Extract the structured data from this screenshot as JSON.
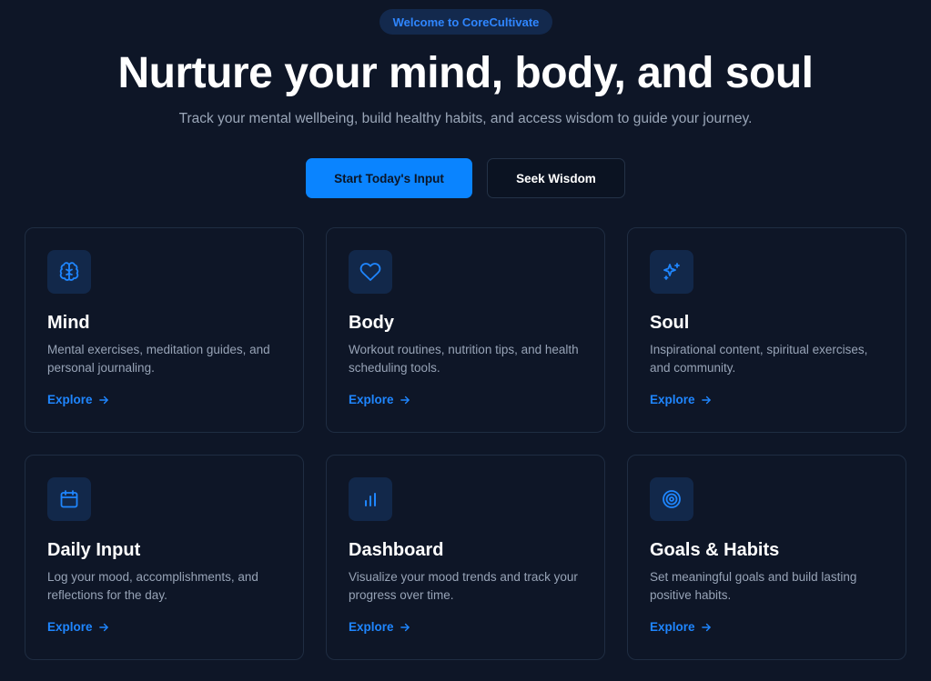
{
  "badge": "Welcome to CoreCultivate",
  "hero": {
    "title": "Nurture your mind, body, and soul",
    "subtitle": "Track your mental wellbeing, build healthy habits, and access wisdom to guide your journey."
  },
  "buttons": {
    "primary": "Start Today's Input",
    "secondary": "Seek Wisdom"
  },
  "colors": {
    "background": "#0e1627",
    "accent": "#0a84ff",
    "icon_bg": "#12284a",
    "muted_text": "#97a3b6"
  },
  "cards": [
    {
      "icon": "brain-icon",
      "title": "Mind",
      "description": "Mental exercises, meditation guides, and personal journaling.",
      "link": "Explore"
    },
    {
      "icon": "heart-icon",
      "title": "Body",
      "description": "Workout routines, nutrition tips, and health scheduling tools.",
      "link": "Explore"
    },
    {
      "icon": "sparkles-icon",
      "title": "Soul",
      "description": "Inspirational content, spiritual exercises, and community.",
      "link": "Explore"
    },
    {
      "icon": "calendar-icon",
      "title": "Daily Input",
      "description": "Log your mood, accomplishments, and reflections for the day.",
      "link": "Explore"
    },
    {
      "icon": "bar-chart-icon",
      "title": "Dashboard",
      "description": "Visualize your mood trends and track your progress over time.",
      "link": "Explore"
    },
    {
      "icon": "target-icon",
      "title": "Goals & Habits",
      "description": "Set meaningful goals and build lasting positive habits.",
      "link": "Explore"
    }
  ]
}
